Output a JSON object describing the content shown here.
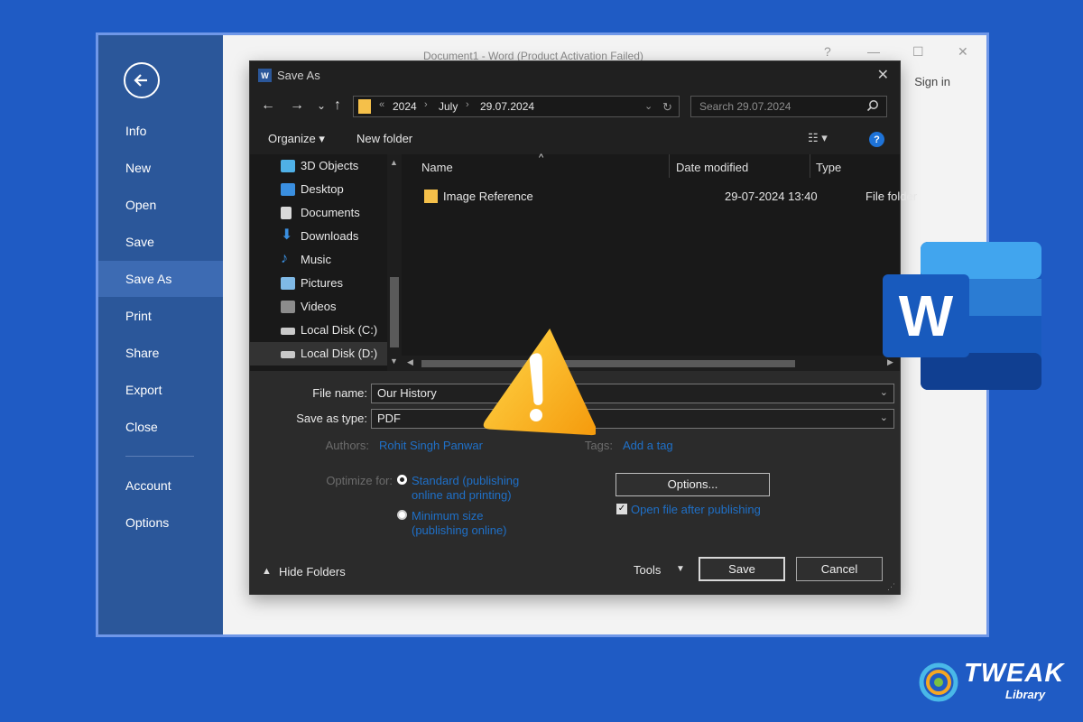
{
  "word": {
    "title": "Document1 - Word (Product Activation Failed)",
    "sign_in": "Sign in",
    "help": "?",
    "minimize": "—",
    "maximize": "☐",
    "close": "✕",
    "backstage": [
      {
        "label": "Info"
      },
      {
        "label": "New"
      },
      {
        "label": "Open"
      },
      {
        "label": "Save"
      },
      {
        "label": "Save As",
        "active": true
      },
      {
        "label": "Print"
      },
      {
        "label": "Share"
      },
      {
        "label": "Export"
      },
      {
        "label": "Close"
      },
      {
        "label": "Account"
      },
      {
        "label": "Options"
      }
    ]
  },
  "dialog": {
    "title": "Save As",
    "app_icon_letter": "W",
    "close": "✕",
    "nav": {
      "back": "←",
      "forward": "→",
      "recent": "⌄",
      "up": "↑"
    },
    "address": {
      "overflow": "«",
      "parts": [
        "2024",
        "July",
        "29.07.2024"
      ],
      "sep": "›",
      "dropdown": "⌄",
      "refresh": "↻"
    },
    "search": {
      "placeholder": "Search 29.07.2024",
      "icon": "search-icon"
    },
    "toolbar": {
      "organize": "Organize ▾",
      "new_folder": "New folder",
      "view": "☷ ▾",
      "help": "?"
    },
    "nav_pane": [
      {
        "label": "3D Objects",
        "icon": "cube-icon",
        "color": "#4fb0e6"
      },
      {
        "label": "Desktop",
        "icon": "desktop-icon",
        "color": "#3a8fe0"
      },
      {
        "label": "Documents",
        "icon": "documents-icon",
        "color": "#d9d9d9"
      },
      {
        "label": "Downloads",
        "icon": "download-icon",
        "color": "#3a8fe0"
      },
      {
        "label": "Music",
        "icon": "music-icon",
        "color": "#3a8fe0"
      },
      {
        "label": "Pictures",
        "icon": "pictures-icon",
        "color": "#7fb9e6"
      },
      {
        "label": "Videos",
        "icon": "videos-icon",
        "color": "#8c8c8c"
      },
      {
        "label": "Local Disk (C:)",
        "icon": "drive-icon",
        "color": "#c9c9c9"
      },
      {
        "label": "Local Disk (D:)",
        "icon": "drive-icon",
        "color": "#c9c9c9",
        "selected": true
      }
    ],
    "columns": {
      "name": "Name",
      "date": "Date modified",
      "type": "Type",
      "sort_indicator": "^"
    },
    "files": [
      {
        "name": "Image Reference",
        "date": "29-07-2024 13:40",
        "type": "File folder"
      }
    ],
    "form": {
      "file_name_label": "File name:",
      "file_name_value": "Our History",
      "save_type_label": "Save as type:",
      "save_type_value": "PDF",
      "authors_label": "Authors:",
      "authors_value": "Rohit Singh Panwar",
      "tags_label": "Tags:",
      "tags_value": "Add a tag",
      "optimize_label": "Optimize for:",
      "opt_standard": "Standard (publishing online and printing)",
      "opt_minimum": "Minimum size (publishing online)",
      "options_button": "Options...",
      "open_after": "Open file after publishing",
      "hide_folders": "Hide Folders",
      "tools": "Tools",
      "save": "Save",
      "cancel": "Cancel"
    }
  },
  "branding": {
    "word_logo_letter": "W",
    "tweak": "TWEAK",
    "library": "Library"
  }
}
